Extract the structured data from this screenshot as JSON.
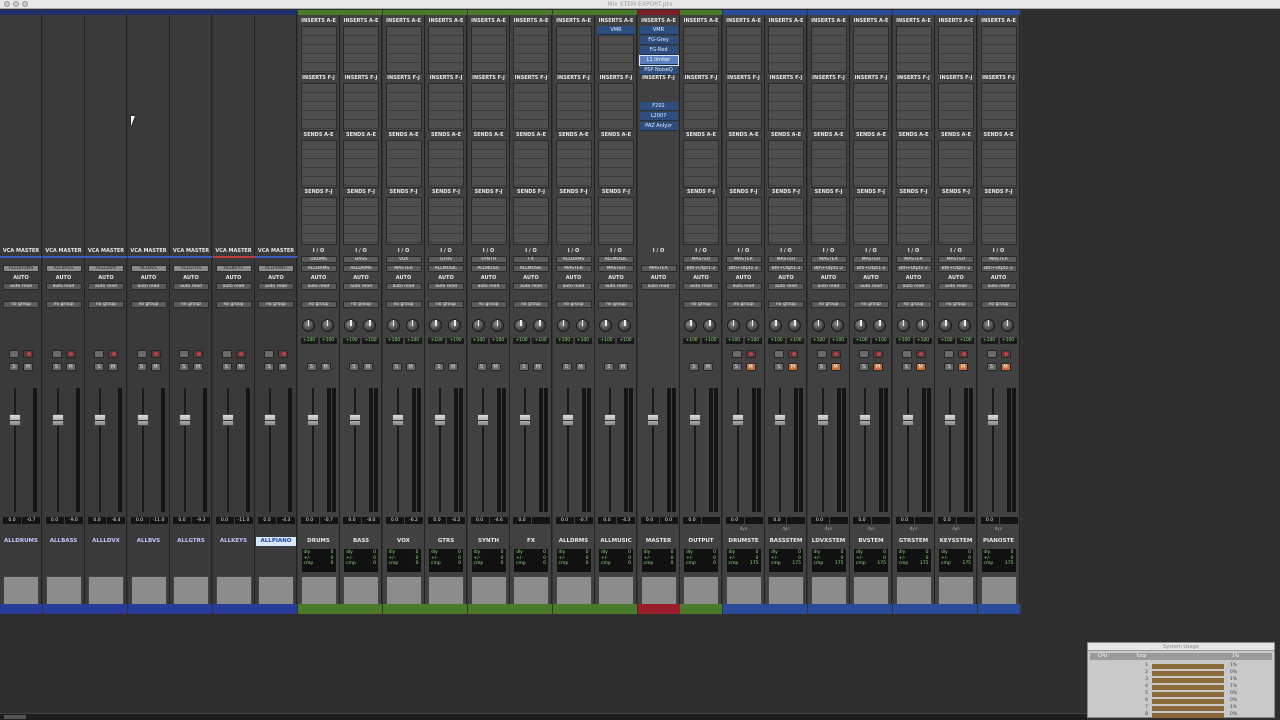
{
  "window": {
    "title": "Mix STEM EXPORT.ptx"
  },
  "section_labels": {
    "inserts_ae": "INSERTS A-E",
    "inserts_fj": "INSERTS F-J",
    "sends_ae": "SENDS A-E",
    "sends_fj": "SENDS F-J",
    "io": "I / O",
    "vca_master": "VCA MASTER",
    "auto_label": "AUTO",
    "auto_mode": "auto read",
    "group": "no group",
    "dyn": "dyn"
  },
  "vca_strips": [
    {
      "name": "ALLDRUMS",
      "target": "ALLDRUMS",
      "fader": "0.0",
      "peak": "-0.7",
      "color": "#3b5fc0"
    },
    {
      "name": "ALLBASS",
      "target": "ALLBASS",
      "fader": "0.0",
      "peak": "-9.0",
      "color": "#3b5fc0"
    },
    {
      "name": "ALLLDVX",
      "target": "ALLLDVX",
      "fader": "0.0",
      "peak": "-8.4",
      "color": "#3b5fc0"
    },
    {
      "name": "ALLBVS",
      "target": "ALLBVS",
      "fader": "0.0",
      "peak": "-11.0",
      "color": "#3b5fc0"
    },
    {
      "name": "ALLGTRS",
      "target": "ALLGTRS",
      "fader": "0.0",
      "peak": "-9.3",
      "color": "#3b5fc0"
    },
    {
      "name": "ALLKEYS",
      "target": "ALLKEYS",
      "fader": "0.0",
      "peak": "-11.0",
      "color": "#c03b3b"
    },
    {
      "name": "ALLPIANO",
      "target": "ALLPIANO",
      "fader": "0.0",
      "peak": "-4.3",
      "color": "#3b5fc0"
    }
  ],
  "channel_strips": [
    {
      "name": "DRUMS",
      "input": "DRUMS",
      "output": "ALLDRMS",
      "fader": "0.0",
      "peak": "-0.7",
      "color": "#4a7a2a"
    },
    {
      "name": "BASS",
      "input": "BASS",
      "output": "ALLDRMS",
      "fader": "0.0",
      "peak": "-8.0",
      "color": "#4a7a2a"
    },
    {
      "name": "VOX",
      "input": "VOX",
      "output": "MASTER",
      "fader": "0.0",
      "peak": "-6.2",
      "color": "#4a7a2a"
    },
    {
      "name": "GTRS",
      "input": "GTRS",
      "output": "ALLMUSIC",
      "fader": "0.0",
      "peak": "-6.2",
      "color": "#4a7a2a"
    },
    {
      "name": "SYNTH",
      "input": "SYNTH",
      "output": "ALLMUSIC",
      "fader": "0.0",
      "peak": "-4.6",
      "color": "#4a7a2a"
    },
    {
      "name": "FX",
      "input": "FX",
      "output": "ALLMUSIC",
      "fader": "0.0",
      "peak": "",
      "color": "#4a7a2a"
    },
    {
      "name": "ALLDRMS",
      "input": "ALLDRMS",
      "output": "MASTER",
      "fader": "0.0",
      "peak": "-0.7",
      "color": "#4a7a2a"
    },
    {
      "name": "ALLMUSIC",
      "input": "ALLMUSIC",
      "output": "MASTER",
      "fader": "0.0",
      "peak": "-4.3",
      "color": "#4a7a2a"
    },
    {
      "name": "MASTER",
      "input": "",
      "output": "MASTER",
      "fader": "0.0",
      "peak": "0.0",
      "color": "#9a1e2a"
    },
    {
      "name": "OUTPUT",
      "input": "MASTER",
      "output": "Bth+Otpt1-2",
      "fader": "0.0",
      "peak": "",
      "color": "#4a7a2a"
    },
    {
      "name": "DRUMSTE",
      "input": "MASTER",
      "output": "Bth+Otpt1-2",
      "fader": "0.0",
      "peak": "",
      "color": "#2a4a9a"
    },
    {
      "name": "BASSSTEM",
      "input": "MASTER",
      "output": "Bth+Otpt1-2",
      "fader": "0.0",
      "peak": "",
      "color": "#2a4a9a"
    },
    {
      "name": "LDVXSTEM",
      "input": "MASTER",
      "output": "Bth+Otpt1-2",
      "fader": "0.0",
      "peak": "",
      "color": "#2a4a9a"
    },
    {
      "name": "BVSTEM",
      "input": "MASTER",
      "output": "Bth+Otpt1-2",
      "fader": "0.0",
      "peak": "",
      "color": "#2a4a9a"
    },
    {
      "name": "GTRSTEM",
      "input": "MASTER",
      "output": "Bth+Otpt1-2",
      "fader": "0.0",
      "peak": "",
      "color": "#2a4a9a"
    },
    {
      "name": "KEYSSTEM",
      "input": "MASTER",
      "output": "Bth+Otpt1-2",
      "fader": "0.0",
      "peak": "",
      "color": "#2a4a9a"
    },
    {
      "name": "PIANOSTE",
      "input": "MASTER",
      "output": "Bth+Otpt1-2",
      "fader": "0.0",
      "peak": "",
      "color": "#2a4a9a"
    }
  ],
  "master_inserts_ae": [
    "VMR",
    "FG-Grey",
    "FG-Red",
    "L1 limiter",
    "PSP NoiseQ"
  ],
  "master_inserts_fj": [
    "F202",
    "L2007",
    "PAZ Anlyzr"
  ],
  "allmusic_insert": "VMR",
  "pan_value": "+100",
  "delay_panel": {
    "dly_label": "dly",
    "dly_value": "0",
    "pm_label": "+/-",
    "pm_value": "0",
    "cmp_label": "cmp",
    "cmp_value": "0",
    "cmp_value_alt": "175"
  },
  "system_usage": {
    "title": "System Usage",
    "col_cpu": "CPU",
    "col_total": "Total",
    "rows": [
      {
        "n": "1",
        "pct": "1%"
      },
      {
        "n": "2",
        "pct": "0%"
      },
      {
        "n": "3",
        "pct": "1%"
      },
      {
        "n": "4",
        "pct": "1%"
      },
      {
        "n": "5",
        "pct": "0%"
      },
      {
        "n": "6",
        "pct": "0%"
      },
      {
        "n": "7",
        "pct": "1%"
      },
      {
        "n": "8",
        "pct": "0%"
      }
    ],
    "total_pct": "1%"
  }
}
